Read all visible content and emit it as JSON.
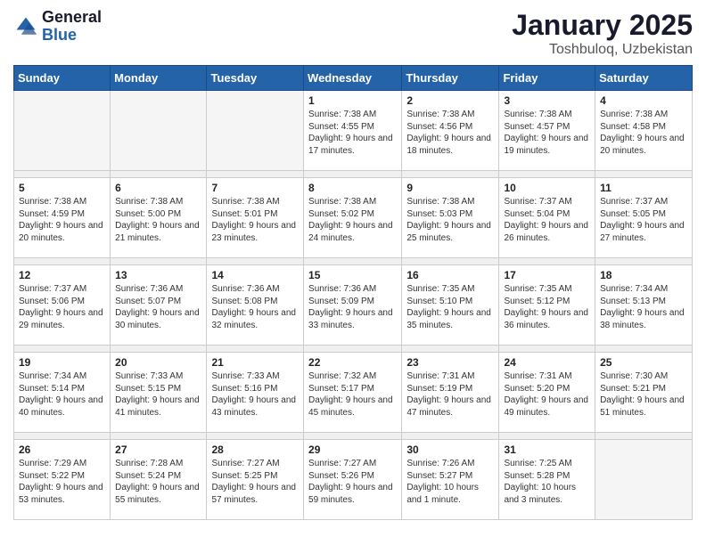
{
  "header": {
    "logo_general": "General",
    "logo_blue": "Blue",
    "month": "January 2025",
    "location": "Toshbuloq, Uzbekistan"
  },
  "weekdays": [
    "Sunday",
    "Monday",
    "Tuesday",
    "Wednesday",
    "Thursday",
    "Friday",
    "Saturday"
  ],
  "weeks": [
    [
      {
        "day": "",
        "sunrise": "",
        "sunset": "",
        "daylight": ""
      },
      {
        "day": "",
        "sunrise": "",
        "sunset": "",
        "daylight": ""
      },
      {
        "day": "",
        "sunrise": "",
        "sunset": "",
        "daylight": ""
      },
      {
        "day": "1",
        "sunrise": "Sunrise: 7:38 AM",
        "sunset": "Sunset: 4:55 PM",
        "daylight": "Daylight: 9 hours and 17 minutes."
      },
      {
        "day": "2",
        "sunrise": "Sunrise: 7:38 AM",
        "sunset": "Sunset: 4:56 PM",
        "daylight": "Daylight: 9 hours and 18 minutes."
      },
      {
        "day": "3",
        "sunrise": "Sunrise: 7:38 AM",
        "sunset": "Sunset: 4:57 PM",
        "daylight": "Daylight: 9 hours and 19 minutes."
      },
      {
        "day": "4",
        "sunrise": "Sunrise: 7:38 AM",
        "sunset": "Sunset: 4:58 PM",
        "daylight": "Daylight: 9 hours and 20 minutes."
      }
    ],
    [
      {
        "day": "5",
        "sunrise": "Sunrise: 7:38 AM",
        "sunset": "Sunset: 4:59 PM",
        "daylight": "Daylight: 9 hours and 20 minutes."
      },
      {
        "day": "6",
        "sunrise": "Sunrise: 7:38 AM",
        "sunset": "Sunset: 5:00 PM",
        "daylight": "Daylight: 9 hours and 21 minutes."
      },
      {
        "day": "7",
        "sunrise": "Sunrise: 7:38 AM",
        "sunset": "Sunset: 5:01 PM",
        "daylight": "Daylight: 9 hours and 23 minutes."
      },
      {
        "day": "8",
        "sunrise": "Sunrise: 7:38 AM",
        "sunset": "Sunset: 5:02 PM",
        "daylight": "Daylight: 9 hours and 24 minutes."
      },
      {
        "day": "9",
        "sunrise": "Sunrise: 7:38 AM",
        "sunset": "Sunset: 5:03 PM",
        "daylight": "Daylight: 9 hours and 25 minutes."
      },
      {
        "day": "10",
        "sunrise": "Sunrise: 7:37 AM",
        "sunset": "Sunset: 5:04 PM",
        "daylight": "Daylight: 9 hours and 26 minutes."
      },
      {
        "day": "11",
        "sunrise": "Sunrise: 7:37 AM",
        "sunset": "Sunset: 5:05 PM",
        "daylight": "Daylight: 9 hours and 27 minutes."
      }
    ],
    [
      {
        "day": "12",
        "sunrise": "Sunrise: 7:37 AM",
        "sunset": "Sunset: 5:06 PM",
        "daylight": "Daylight: 9 hours and 29 minutes."
      },
      {
        "day": "13",
        "sunrise": "Sunrise: 7:36 AM",
        "sunset": "Sunset: 5:07 PM",
        "daylight": "Daylight: 9 hours and 30 minutes."
      },
      {
        "day": "14",
        "sunrise": "Sunrise: 7:36 AM",
        "sunset": "Sunset: 5:08 PM",
        "daylight": "Daylight: 9 hours and 32 minutes."
      },
      {
        "day": "15",
        "sunrise": "Sunrise: 7:36 AM",
        "sunset": "Sunset: 5:09 PM",
        "daylight": "Daylight: 9 hours and 33 minutes."
      },
      {
        "day": "16",
        "sunrise": "Sunrise: 7:35 AM",
        "sunset": "Sunset: 5:10 PM",
        "daylight": "Daylight: 9 hours and 35 minutes."
      },
      {
        "day": "17",
        "sunrise": "Sunrise: 7:35 AM",
        "sunset": "Sunset: 5:12 PM",
        "daylight": "Daylight: 9 hours and 36 minutes."
      },
      {
        "day": "18",
        "sunrise": "Sunrise: 7:34 AM",
        "sunset": "Sunset: 5:13 PM",
        "daylight": "Daylight: 9 hours and 38 minutes."
      }
    ],
    [
      {
        "day": "19",
        "sunrise": "Sunrise: 7:34 AM",
        "sunset": "Sunset: 5:14 PM",
        "daylight": "Daylight: 9 hours and 40 minutes."
      },
      {
        "day": "20",
        "sunrise": "Sunrise: 7:33 AM",
        "sunset": "Sunset: 5:15 PM",
        "daylight": "Daylight: 9 hours and 41 minutes."
      },
      {
        "day": "21",
        "sunrise": "Sunrise: 7:33 AM",
        "sunset": "Sunset: 5:16 PM",
        "daylight": "Daylight: 9 hours and 43 minutes."
      },
      {
        "day": "22",
        "sunrise": "Sunrise: 7:32 AM",
        "sunset": "Sunset: 5:17 PM",
        "daylight": "Daylight: 9 hours and 45 minutes."
      },
      {
        "day": "23",
        "sunrise": "Sunrise: 7:31 AM",
        "sunset": "Sunset: 5:19 PM",
        "daylight": "Daylight: 9 hours and 47 minutes."
      },
      {
        "day": "24",
        "sunrise": "Sunrise: 7:31 AM",
        "sunset": "Sunset: 5:20 PM",
        "daylight": "Daylight: 9 hours and 49 minutes."
      },
      {
        "day": "25",
        "sunrise": "Sunrise: 7:30 AM",
        "sunset": "Sunset: 5:21 PM",
        "daylight": "Daylight: 9 hours and 51 minutes."
      }
    ],
    [
      {
        "day": "26",
        "sunrise": "Sunrise: 7:29 AM",
        "sunset": "Sunset: 5:22 PM",
        "daylight": "Daylight: 9 hours and 53 minutes."
      },
      {
        "day": "27",
        "sunrise": "Sunrise: 7:28 AM",
        "sunset": "Sunset: 5:24 PM",
        "daylight": "Daylight: 9 hours and 55 minutes."
      },
      {
        "day": "28",
        "sunrise": "Sunrise: 7:27 AM",
        "sunset": "Sunset: 5:25 PM",
        "daylight": "Daylight: 9 hours and 57 minutes."
      },
      {
        "day": "29",
        "sunrise": "Sunrise: 7:27 AM",
        "sunset": "Sunset: 5:26 PM",
        "daylight": "Daylight: 9 hours and 59 minutes."
      },
      {
        "day": "30",
        "sunrise": "Sunrise: 7:26 AM",
        "sunset": "Sunset: 5:27 PM",
        "daylight": "Daylight: 10 hours and 1 minute."
      },
      {
        "day": "31",
        "sunrise": "Sunrise: 7:25 AM",
        "sunset": "Sunset: 5:28 PM",
        "daylight": "Daylight: 10 hours and 3 minutes."
      },
      {
        "day": "",
        "sunrise": "",
        "sunset": "",
        "daylight": ""
      }
    ]
  ]
}
